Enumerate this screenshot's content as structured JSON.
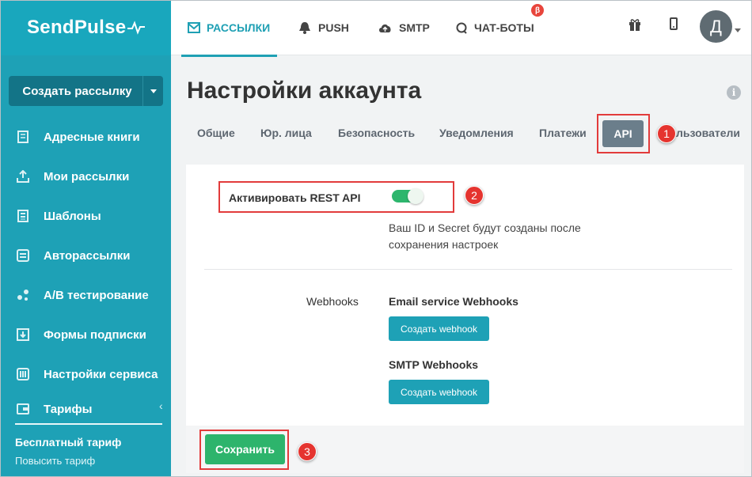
{
  "app": {
    "logo": "SendPulse"
  },
  "sidebar": {
    "create_button": "Создать рассылку",
    "items": [
      {
        "label": "Адресные книги",
        "icon": "book-icon"
      },
      {
        "label": "Мои рассылки",
        "icon": "upload-icon"
      },
      {
        "label": "Шаблоны",
        "icon": "template-icon"
      },
      {
        "label": "Авторассылки",
        "icon": "automation-icon"
      },
      {
        "label": "A/B тестирование",
        "icon": "ab-test-icon"
      },
      {
        "label": "Формы подписки",
        "icon": "form-icon"
      },
      {
        "label": "Настройки сервиса",
        "icon": "settings-sliders-icon"
      },
      {
        "label": "Тарифы",
        "icon": "wallet-icon"
      }
    ],
    "plan_name": "Бесплатный тариф",
    "plan_upgrade": "Повысить тариф"
  },
  "topnav": {
    "items": [
      {
        "label": "РАССЫЛКИ",
        "icon": "mail-icon",
        "active": true
      },
      {
        "label": "PUSH",
        "icon": "bell-icon"
      },
      {
        "label": "SMTP",
        "icon": "cloud-upload-icon"
      },
      {
        "label": "ЧАТ-БОТЫ",
        "icon": "chat-icon"
      }
    ],
    "beta_badge": "β",
    "avatar_initial": "Д"
  },
  "page": {
    "title": "Настройки аккаунта",
    "info": "i",
    "tabs": [
      "Общие",
      "Юр. лица",
      "Безопасность",
      "Уведомления",
      "Платежи",
      "API",
      "льзователи"
    ],
    "active_tab": "API"
  },
  "api": {
    "toggle_label": "Активировать REST API",
    "toggle_on": true,
    "hint_line1": "Ваш ID и Secret будут созданы после",
    "hint_line2": "сохранения настроек",
    "webhooks_label": "Webhooks",
    "email_title": "Email service Webhooks",
    "email_button": "Создать webhook",
    "smtp_title": "SMTP Webhooks",
    "smtp_button": "Создать webhook",
    "save_button": "Сохранить"
  },
  "annotations": [
    "1",
    "2",
    "3"
  ],
  "colors": {
    "brand": "#1ea1b6",
    "save": "#2db46c",
    "highlight": "#e23b3b",
    "active_tab": "#6b7e8b"
  }
}
